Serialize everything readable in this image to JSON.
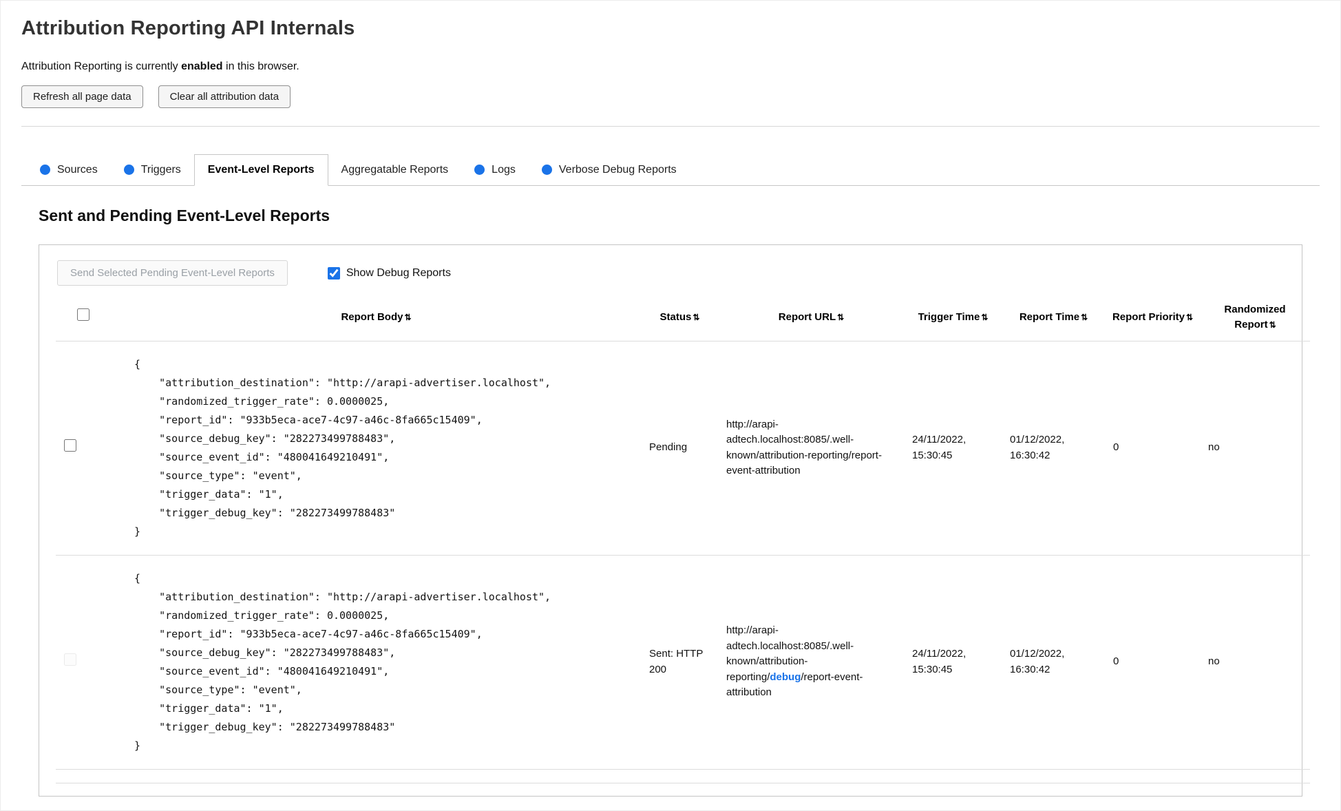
{
  "page": {
    "title": "Attribution Reporting API Internals",
    "status_prefix": "Attribution Reporting is currently ",
    "status_bold": "enabled",
    "status_suffix": " in this browser.",
    "refresh_button": "Refresh all page data",
    "clear_button": "Clear all attribution data"
  },
  "colors": {
    "accent": "#1a73e8",
    "tab_border": "#c6c6c6"
  },
  "icons": {
    "sort": "⇅",
    "new_data_dot": "●"
  },
  "tabs": [
    {
      "label": "Sources"
    },
    {
      "label": "Triggers"
    },
    {
      "label": "Event-Level Reports"
    },
    {
      "label": "Aggregatable Reports"
    },
    {
      "label": "Logs"
    },
    {
      "label": "Verbose Debug Reports"
    }
  ],
  "section": {
    "title": "Sent and Pending Event-Level Reports",
    "send_button": "Send Selected Pending Event-Level Reports",
    "send_button_disabled": "disabled",
    "show_debug_label": "Show Debug Reports",
    "show_debug_checked": "checked"
  },
  "table": {
    "headers": [
      "Report Body",
      "Status",
      "Report URL",
      "Trigger Time",
      "Report Time",
      "Report Priority",
      "Randomized Report"
    ],
    "rows": [
      {
        "body": "{\n    \"attribution_destination\": \"http://arapi-advertiser.localhost\",\n    \"randomized_trigger_rate\": 0.0000025,\n    \"report_id\": \"933b5eca-ace7-4c97-a46c-8fa665c15409\",\n    \"source_debug_key\": \"282273499788483\",\n    \"source_event_id\": \"480041649210491\",\n    \"source_type\": \"event\",\n    \"trigger_data\": \"1\",\n    \"trigger_debug_key\": \"282273499788483\"\n}",
        "status": "Pending",
        "url": "http://arapi-adtech.localhost:8085/.well-known/attribution-reporting/report-event-attribution",
        "trigger_time": "24/11/2022, 15:30:45",
        "report_time": "01/12/2022, 16:30:42",
        "priority": "0",
        "randomized": "no"
      },
      {
        "body": "{\n    \"attribution_destination\": \"http://arapi-advertiser.localhost\",\n    \"randomized_trigger_rate\": 0.0000025,\n    \"report_id\": \"933b5eca-ace7-4c97-a46c-8fa665c15409\",\n    \"source_debug_key\": \"282273499788483\",\n    \"source_event_id\": \"480041649210491\",\n    \"source_type\": \"event\",\n    \"trigger_data\": \"1\",\n    \"trigger_debug_key\": \"282273499788483\"\n}",
        "status": "Sent: HTTP 200",
        "url_before": "http://arapi-adtech.localhost:8085/.well-known/attribution-reporting/",
        "url_debug": "debug",
        "url_after": "/report-event-attribution",
        "trigger_time": "24/11/2022, 15:30:45",
        "report_time": "01/12/2022, 16:30:42",
        "priority": "0",
        "randomized": "no",
        "checkbox_disabled": "disabled"
      }
    ]
  }
}
